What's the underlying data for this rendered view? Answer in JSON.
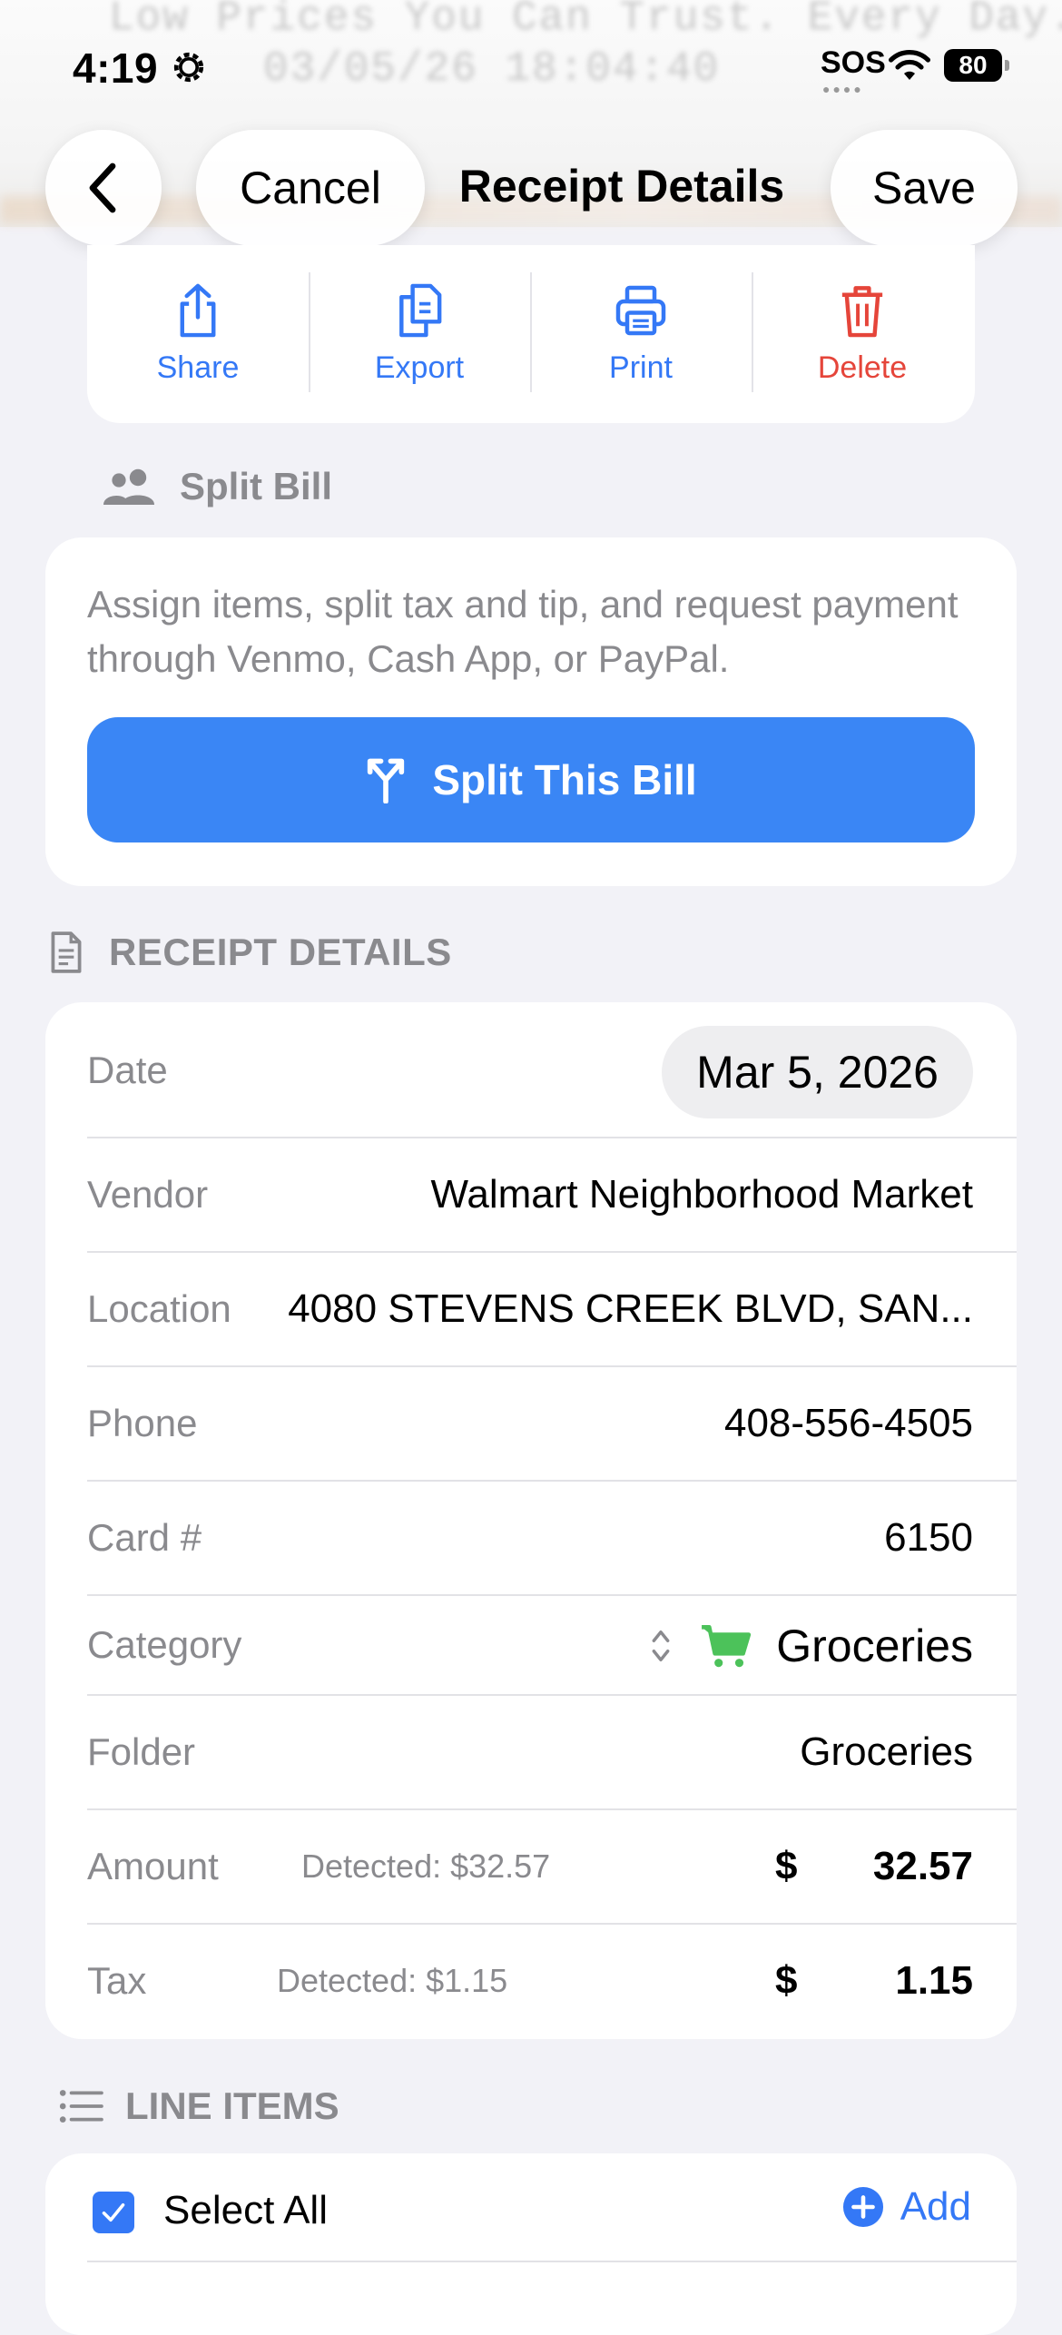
{
  "backdrop": {
    "line1": "Low Prices You Can Trust. Every Day.",
    "line2": "03/05/26      18:04:40"
  },
  "status_bar": {
    "time": "4:19",
    "sos": "SOS",
    "battery": "80"
  },
  "nav": {
    "cancel": "Cancel",
    "title": "Receipt Details",
    "save": "Save"
  },
  "actions": {
    "share": "Share",
    "export": "Export",
    "print": "Print",
    "delete": "Delete"
  },
  "split_bill": {
    "header": "Split Bill",
    "description": "Assign items, split tax and tip, and request payment through Venmo, Cash App, or PayPal.",
    "button": "Split This Bill"
  },
  "receipt_details": {
    "header": "RECEIPT DETAILS",
    "date_label": "Date",
    "date_value": "Mar 5, 2026",
    "vendor_label": "Vendor",
    "vendor_value": "Walmart Neighborhood Market",
    "location_label": "Location",
    "location_value": "4080 STEVENS CREEK BLVD, SAN...",
    "phone_label": "Phone",
    "phone_value": "408-556-4505",
    "card_label": "Card #",
    "card_value": "6150",
    "category_label": "Category",
    "category_value": "Groceries",
    "folder_label": "Folder",
    "folder_value": "Groceries",
    "amount_label": "Amount",
    "amount_detected": "Detected: $32.57",
    "amount_currency": "$",
    "amount_value": "32.57",
    "tax_label": "Tax",
    "tax_detected": "Detected: $1.15",
    "tax_currency": "$",
    "tax_value": "1.15"
  },
  "line_items": {
    "header": "LINE ITEMS",
    "select_all": "Select All",
    "add": "Add"
  },
  "colors": {
    "accent": "#3478f6",
    "destructive": "#e5453a",
    "category_icon": "#4cc25a",
    "background": "#f2f2f7"
  }
}
